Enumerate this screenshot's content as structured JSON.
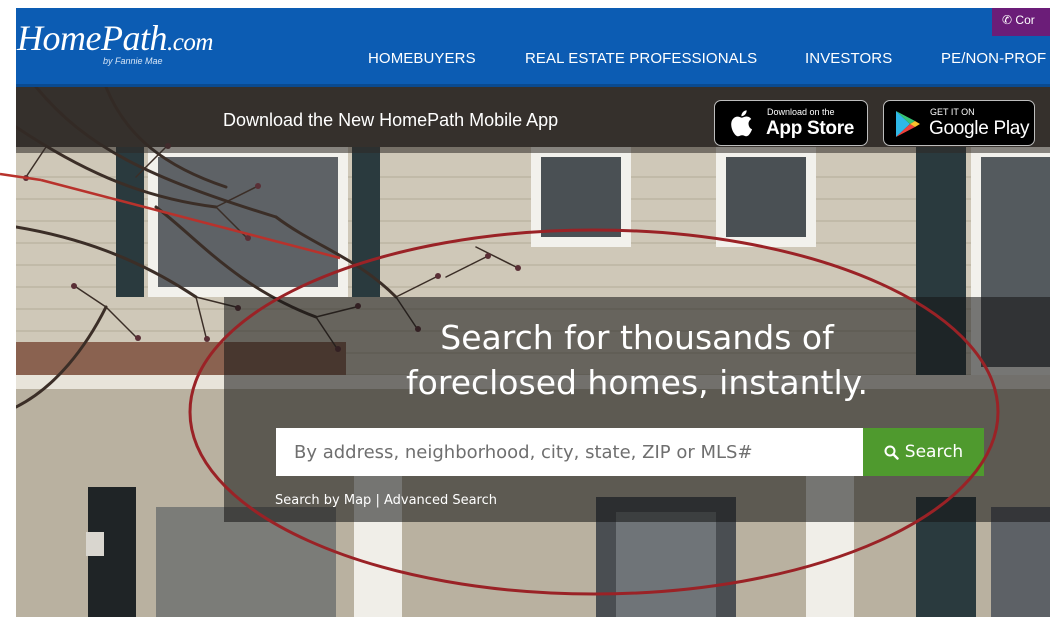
{
  "header": {
    "logo_main": "HomePath",
    "logo_domain": ".com",
    "logo_sub": "by Fannie Mae",
    "contact_label": "Cor",
    "nav": [
      {
        "label": "HOMEBUYERS"
      },
      {
        "label": "REAL ESTATE PROFESSIONALS"
      },
      {
        "label": "INVESTORS"
      },
      {
        "label": "PE/NON-PROF"
      }
    ]
  },
  "app_bar": {
    "text": "Download the New HomePath Mobile App",
    "apple": {
      "small": "Download on the",
      "big": "App Store",
      "icon": "apple-icon"
    },
    "google": {
      "small": "GET IT ON",
      "big": "Google Play",
      "icon": "google-play-icon"
    }
  },
  "hero": {
    "headline_line1": "Search for thousands of",
    "headline_line2": "foreclosed homes, instantly."
  },
  "search": {
    "placeholder": "By address, neighborhood, city, state, ZIP or MLS#",
    "value": "",
    "button_label": "Search",
    "button_icon": "search-icon",
    "map_link": "Search by Map",
    "separator": "|",
    "advanced_link": "Advanced Search"
  },
  "colors": {
    "header_blue": "#0c5cb3",
    "contact_purple": "#6b1d78",
    "search_green": "#4f9a2e",
    "annotation_red": "#b8322c"
  }
}
